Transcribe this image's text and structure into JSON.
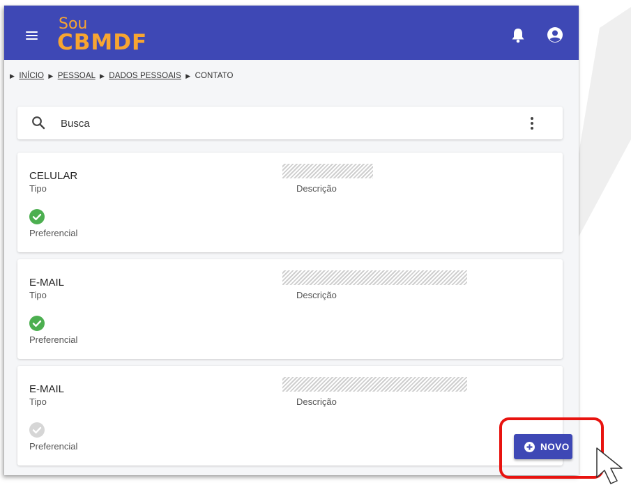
{
  "header": {
    "logo_top": "Sou",
    "logo_bottom": "CBMDF"
  },
  "breadcrumb": [
    {
      "label": "INÍCIO",
      "link": true
    },
    {
      "label": "PESSOAL",
      "link": true
    },
    {
      "label": "DADOS PESSOAIS",
      "link": true
    },
    {
      "label": "CONTATO",
      "link": false
    }
  ],
  "search": {
    "placeholder": "Busca",
    "value": ""
  },
  "labels": {
    "tipo": "Tipo",
    "descricao": "Descrição",
    "preferencial": "Preferencial"
  },
  "contacts": [
    {
      "tipo": "CELULAR",
      "descricao": "[redacted]",
      "preferencial": true
    },
    {
      "tipo": "E-MAIL",
      "descricao": "[redacted]",
      "preferencial": true
    },
    {
      "tipo": "E-MAIL",
      "descricao": "[redacted]",
      "preferencial": false
    }
  ],
  "actions": {
    "new_label": "NOVO"
  },
  "colors": {
    "primary": "#3e48b5",
    "logo": "#f7a531",
    "preferred_on": "#4caf50",
    "preferred_off": "#d6d6d6",
    "highlight": "#e8130f"
  },
  "icons": {
    "menu": "menu-icon",
    "notifications": "bell-icon",
    "account": "user-circle-icon",
    "search": "search-icon",
    "more": "kebab-icon",
    "preferred": "check-circle-icon",
    "add": "plus-circle-icon"
  }
}
